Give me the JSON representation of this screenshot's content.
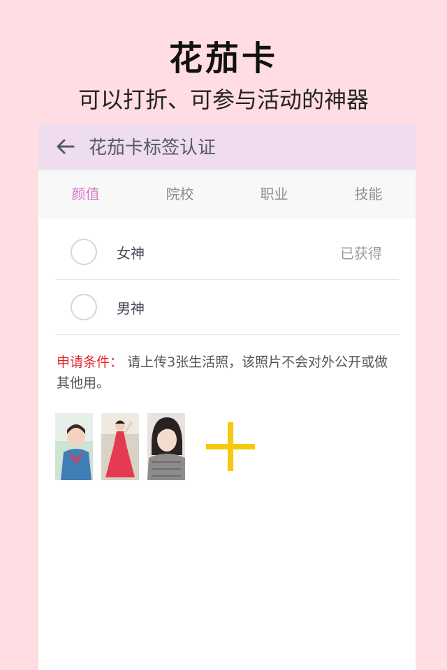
{
  "promo": {
    "title": "花茄卡",
    "subtitle": "可以打折、可参与活动的神器"
  },
  "appbar": {
    "title": "花茄卡标签认证",
    "back_icon": "arrow-left-icon"
  },
  "tabs": [
    {
      "label": "颜值",
      "active": true
    },
    {
      "label": "院校",
      "active": false
    },
    {
      "label": "职业",
      "active": false
    },
    {
      "label": "技能",
      "active": false
    }
  ],
  "tags": [
    {
      "label": "女神",
      "status": "已获得"
    },
    {
      "label": "男神",
      "status": ""
    }
  ],
  "conditions": {
    "label": "申请条件：",
    "text": "请上传3张生活照，该照片不会对外公开或做其他用。"
  },
  "photos": [
    {
      "name": "photo-1"
    },
    {
      "name": "photo-2"
    },
    {
      "name": "photo-3"
    }
  ],
  "colors": {
    "background": "#ffdde3",
    "appbar": "#efdcee",
    "active_tab": "#d97ac8",
    "condition_label": "#e8262d",
    "add_button": "#f6c80f"
  }
}
